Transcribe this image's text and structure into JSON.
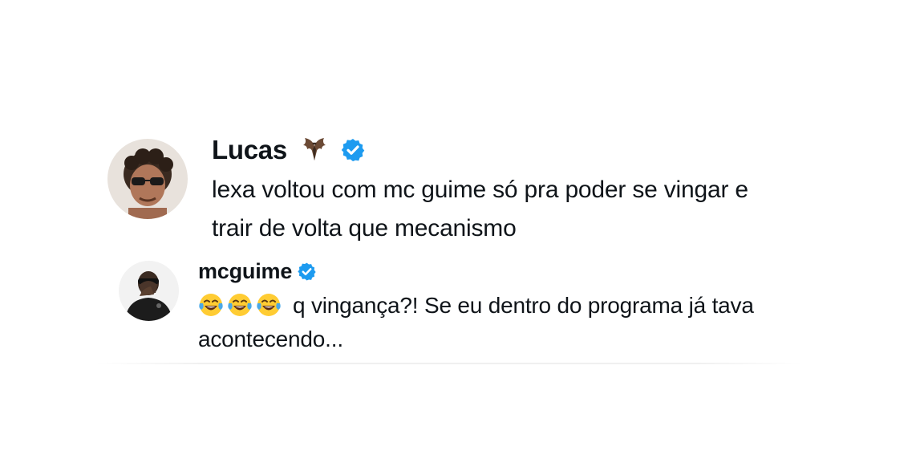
{
  "posts": [
    {
      "display_name": "Lucas",
      "text": "lexa voltou com mc guime só pra poder se vingar e trair de volta que mecanismo",
      "badges": [
        "bat-emoji-icon",
        "verified-badge-icon"
      ]
    },
    {
      "display_name": "mcguime",
      "emojis": [
        "face-with-tears-of-joy-icon",
        "face-with-tears-of-joy-icon",
        "face-with-tears-of-joy-icon"
      ],
      "text": "q vingança?! Se eu dentro do programa já tava acontecendo...",
      "badges": [
        "verified-badge-icon"
      ]
    }
  ],
  "colors": {
    "verified_blue": "#1d9bf0",
    "text": "#0f1419",
    "background": "#ffffff",
    "emoji_yellow": "#ffcc33",
    "tears_blue": "#4aa8e8"
  }
}
